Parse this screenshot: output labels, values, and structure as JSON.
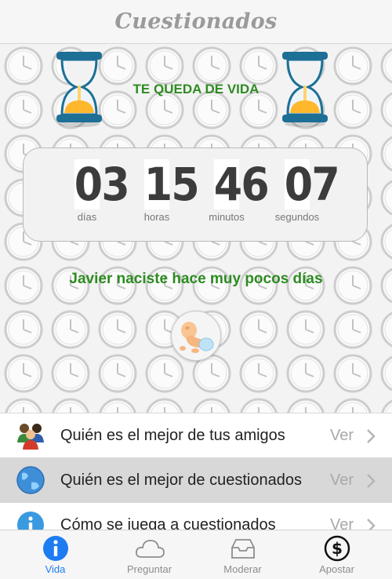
{
  "header": {
    "title": "Cuestionados"
  },
  "countdown": {
    "label": "TE QUEDA DE VIDA",
    "units": [
      {
        "value": "03",
        "label": "días"
      },
      {
        "value": "15",
        "label": "horas"
      },
      {
        "value": "46",
        "label": "minutos"
      },
      {
        "value": "07",
        "label": "segundos"
      }
    ]
  },
  "message": "Javier naciste hace muy pocos días",
  "list": [
    {
      "text": "Quién es el mejor de tus amigos",
      "action": "Ver",
      "icon": "friends-icon"
    },
    {
      "text": "Quién es el mejor de cuestionados",
      "action": "Ver",
      "icon": "globe-icon"
    },
    {
      "text": "Cómo se juega a cuestionados",
      "action": "Ver",
      "icon": "info-icon"
    }
  ],
  "tabs": [
    {
      "label": "Vida",
      "icon": "info-icon",
      "active": true
    },
    {
      "label": "Preguntar",
      "icon": "cloud-icon"
    },
    {
      "label": "Moderar",
      "icon": "inbox-icon"
    },
    {
      "label": "Apostar",
      "icon": "dollar-icon"
    }
  ],
  "colors": {
    "accent_green": "#2e8b22",
    "tab_active": "#1d7cf2",
    "selected_row": "#d8d8d8"
  }
}
